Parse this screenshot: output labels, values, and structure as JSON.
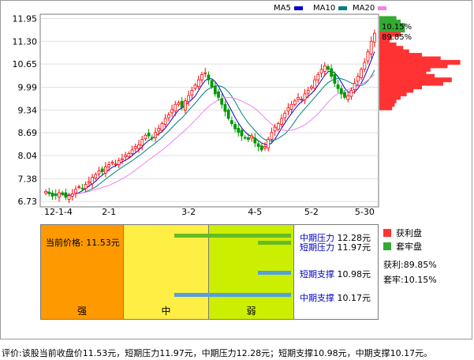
{
  "legend": [
    {
      "name": "MA5",
      "color": "#0000cc"
    },
    {
      "name": "MA10",
      "color": "#008080"
    },
    {
      "name": "MA20",
      "color": "#ee82ee"
    }
  ],
  "chart_data": {
    "type": "candlestick",
    "yticks": [
      "11.95",
      "11.30",
      "10.65",
      "9.99",
      "9.34",
      "8.69",
      "8.04",
      "7.38",
      "6.73"
    ],
    "xticks": [
      "12-1-4",
      "2-1",
      "3-2",
      "4-5",
      "5-2",
      "5-30"
    ],
    "ylim": [
      6.6,
      12.05
    ],
    "up_color": "#ff0000",
    "down_color": "#009900",
    "closes": [
      7.02,
      6.95,
      6.88,
      6.9,
      6.98,
      6.94,
      6.85,
      6.9,
      6.95,
      7.08,
      7.15,
      7.1,
      7.22,
      7.3,
      7.42,
      7.5,
      7.6,
      7.58,
      7.72,
      7.78,
      7.85,
      7.8,
      7.9,
      7.95,
      8.05,
      8.1,
      8.2,
      8.3,
      8.35,
      8.5,
      8.62,
      8.6,
      8.55,
      8.7,
      8.82,
      8.95,
      9.1,
      9.2,
      9.35,
      9.5,
      9.55,
      9.4,
      9.6,
      9.75,
      9.9,
      10.05,
      10.2,
      10.35,
      10.4,
      10.2,
      10.0,
      9.8,
      9.7,
      9.5,
      9.3,
      9.1,
      8.95,
      8.8,
      8.7,
      8.6,
      8.55,
      8.5,
      8.6,
      8.4,
      8.3,
      8.2,
      8.3,
      8.5,
      8.7,
      8.85,
      8.95,
      9.1,
      9.25,
      9.4,
      9.5,
      9.6,
      9.7,
      9.65,
      9.8,
      9.9,
      10.0,
      10.2,
      10.35,
      10.5,
      10.6,
      10.5,
      10.3,
      10.1,
      9.95,
      9.8,
      9.7,
      9.75,
      9.9,
      10.1,
      10.3,
      10.5,
      10.7,
      11.0,
      11.3,
      11.53
    ],
    "ma_colors": {
      "ma5": "#0000cc",
      "ma10": "#008080",
      "ma20": "#ee82ee"
    },
    "chip_distribution": {
      "profit_pct": "89.85%",
      "trapped_pct": "10.15%",
      "profit_color": "#ff3333",
      "trapped_color": "#33aa33",
      "bins": [
        {
          "price": 11.95,
          "w": 0.2,
          "profit": false
        },
        {
          "price": 11.85,
          "w": 0.25,
          "profit": false
        },
        {
          "price": 11.75,
          "w": 0.3,
          "profit": false
        },
        {
          "price": 11.62,
          "w": 0.3,
          "profit": false
        },
        {
          "price": 11.5,
          "w": 0.25,
          "profit": true
        },
        {
          "price": 11.4,
          "w": 0.15,
          "profit": true
        },
        {
          "price": 11.3,
          "w": 0.12,
          "profit": true
        },
        {
          "price": 11.2,
          "w": 0.2,
          "profit": true
        },
        {
          "price": 11.1,
          "w": 0.28,
          "profit": true
        },
        {
          "price": 11.0,
          "w": 0.35,
          "profit": true
        },
        {
          "price": 10.9,
          "w": 0.5,
          "profit": true
        },
        {
          "price": 10.8,
          "w": 0.72,
          "profit": true
        },
        {
          "price": 10.7,
          "w": 0.95,
          "profit": true
        },
        {
          "price": 10.6,
          "w": 0.8,
          "profit": true
        },
        {
          "price": 10.5,
          "w": 0.6,
          "profit": true
        },
        {
          "price": 10.4,
          "w": 0.55,
          "profit": true
        },
        {
          "price": 10.3,
          "w": 0.65,
          "profit": true
        },
        {
          "price": 10.2,
          "w": 0.85,
          "profit": true
        },
        {
          "price": 10.1,
          "w": 0.75,
          "profit": true
        },
        {
          "price": 10.0,
          "w": 0.5,
          "profit": true
        },
        {
          "price": 9.9,
          "w": 0.4,
          "profit": true
        },
        {
          "price": 9.8,
          "w": 0.32,
          "profit": true
        },
        {
          "price": 9.7,
          "w": 0.25,
          "profit": true
        },
        {
          "price": 9.6,
          "w": 0.2,
          "profit": true
        },
        {
          "price": 9.5,
          "w": 0.18,
          "profit": true
        },
        {
          "price": 9.4,
          "w": 0.15,
          "profit": true
        }
      ]
    }
  },
  "analysis": {
    "current_price": "当前价格: 11.53元",
    "zones": [
      {
        "label": "强",
        "color": "#ff9900"
      },
      {
        "label": "中",
        "color": "#ffee44"
      },
      {
        "label": "弱",
        "color": "#ccee00"
      }
    ],
    "levels": [
      {
        "name": "中期压力",
        "value": "12.28元",
        "bar_color": "#66bb22",
        "fraction": 0.89
      },
      {
        "name": "短期压力",
        "value": "11.97元",
        "bar_color": "#66bb22",
        "fraction": 0.92
      },
      {
        "name": "短期支撑",
        "value": "10.98元",
        "bar_color": "#55a0dd",
        "fraction": 0.97
      },
      {
        "name": "中期支撑",
        "value": "10.17元",
        "bar_color": "#55a0dd",
        "fraction": 0.95
      }
    ]
  },
  "side_legend": {
    "profit_label": "获利盘",
    "trapped_label": "套牢盘",
    "profit_text": "获利:89.85%",
    "trapped_text": "套牢:10.15%"
  },
  "summary": "评价:该股当前收盘价11.53元，短期压力11.97元，中期压力12.28元；短期支撑10.98元，中期支撑10.17元。"
}
